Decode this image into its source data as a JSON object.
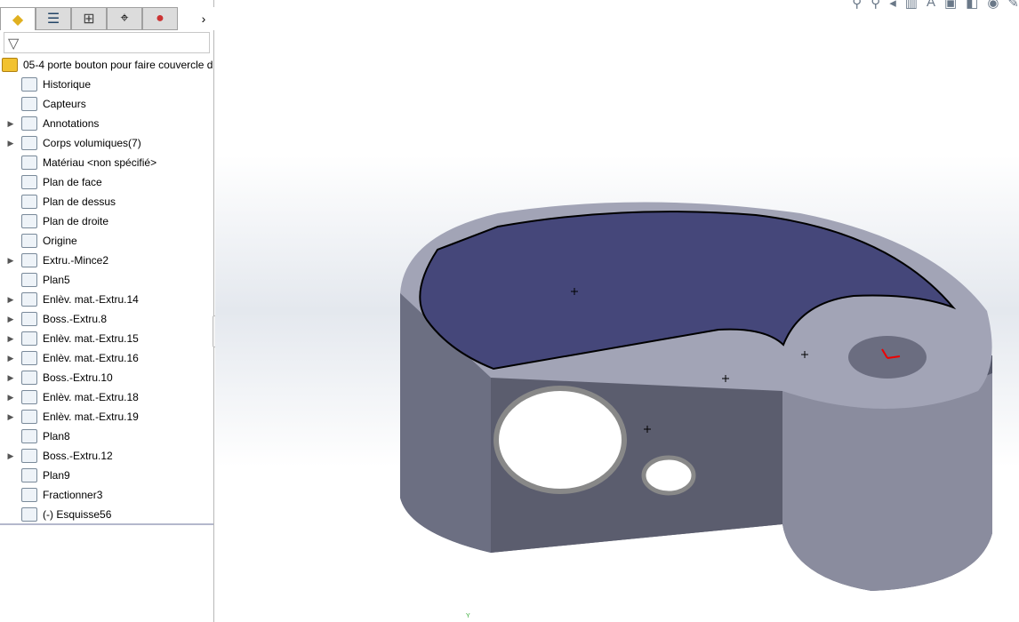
{
  "tabs": [
    {
      "name": "featuremanager",
      "icon": "parts-icon"
    },
    {
      "name": "propertymanager",
      "icon": "properties-icon"
    },
    {
      "name": "configurationmanager",
      "icon": "config-icon"
    },
    {
      "name": "dimxpert",
      "icon": "crosshair-icon"
    },
    {
      "name": "appearances",
      "icon": "color-wheel-icon"
    }
  ],
  "more": "›",
  "filter_icon": "▽",
  "tree": {
    "root": "05-4 porte bouton pour faire couvercle d",
    "items": [
      {
        "label": "Historique",
        "expand": false
      },
      {
        "label": "Capteurs",
        "expand": false
      },
      {
        "label": "Annotations",
        "expand": true
      },
      {
        "label": "Corps volumiques(7)",
        "expand": true
      },
      {
        "label": "Matériau <non spécifié>",
        "expand": false
      },
      {
        "label": "Plan de face",
        "expand": false
      },
      {
        "label": "Plan de dessus",
        "expand": false
      },
      {
        "label": "Plan de droite",
        "expand": false
      },
      {
        "label": "Origine",
        "expand": false
      },
      {
        "label": "Extru.-Mince2",
        "expand": true
      },
      {
        "label": "Plan5",
        "expand": false
      },
      {
        "label": "Enlèv. mat.-Extru.14",
        "expand": true
      },
      {
        "label": "Boss.-Extru.8",
        "expand": true
      },
      {
        "label": "Enlèv. mat.-Extru.15",
        "expand": true
      },
      {
        "label": "Enlèv. mat.-Extru.16",
        "expand": true
      },
      {
        "label": "Boss.-Extru.10",
        "expand": true
      },
      {
        "label": "Enlèv. mat.-Extru.18",
        "expand": true
      },
      {
        "label": "Enlèv. mat.-Extru.19",
        "expand": true
      },
      {
        "label": "Plan8",
        "expand": false
      },
      {
        "label": "Boss.-Extru.12",
        "expand": true
      },
      {
        "label": "Plan9",
        "expand": false
      },
      {
        "label": "Fractionner3",
        "expand": false
      },
      {
        "label": "(-) Esquisse56",
        "expand": false
      }
    ]
  },
  "axis_label": "Y"
}
